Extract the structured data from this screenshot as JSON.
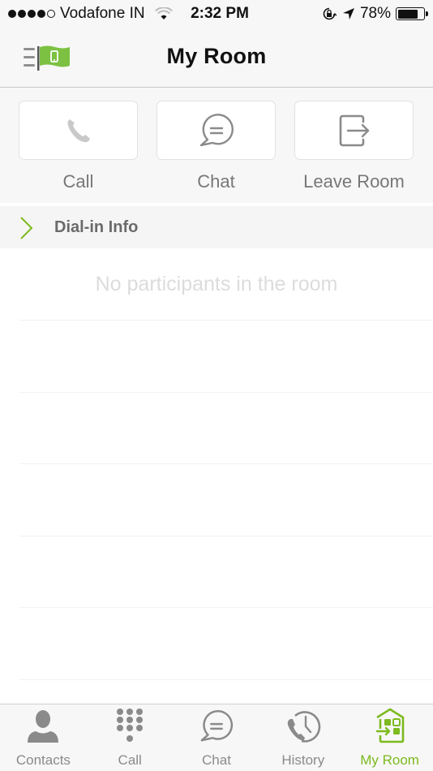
{
  "status_bar": {
    "signal_bars_filled": 4,
    "signal_bars_total": 5,
    "carrier": "Vodafone IN",
    "time": "2:32 PM",
    "battery_percent_label": "78%",
    "battery_level": 0.78
  },
  "header": {
    "title": "My Room",
    "menu_icon": "menu-flag-icon"
  },
  "actions": [
    {
      "label": "Call",
      "icon": "phone-icon"
    },
    {
      "label": "Chat",
      "icon": "chat-bubble-icon"
    },
    {
      "label": "Leave Room",
      "icon": "exit-icon"
    }
  ],
  "dial_in": {
    "label": "Dial-in Info",
    "icon": "chevron-right-icon"
  },
  "participants": {
    "empty_message": "No participants in the room"
  },
  "tabs": [
    {
      "label": "Contacts",
      "icon": "person-icon",
      "active": false
    },
    {
      "label": "Call",
      "icon": "keypad-icon",
      "active": false
    },
    {
      "label": "Chat",
      "icon": "chat-bubble-icon",
      "active": false
    },
    {
      "label": "History",
      "icon": "call-history-icon",
      "active": false
    },
    {
      "label": "My Room",
      "icon": "room-icon",
      "active": true
    }
  ],
  "colors": {
    "accent": "#7cba1f",
    "icon_gray": "#8a8a8a",
    "bar_background": "#f7f7f7"
  }
}
